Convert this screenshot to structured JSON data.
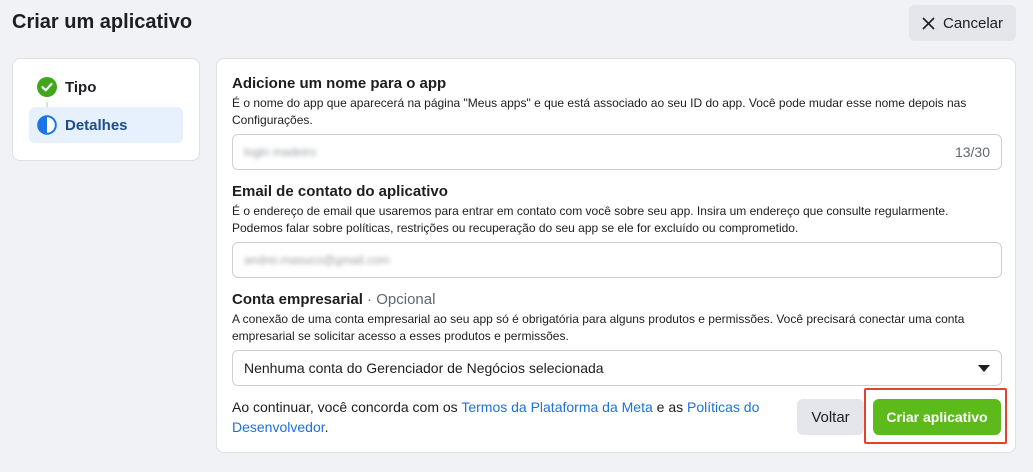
{
  "header": {
    "title": "Criar um aplicativo",
    "cancel_label": "Cancelar"
  },
  "steps": [
    {
      "label": "Tipo",
      "state": "completed",
      "icon": "check-circle-icon"
    },
    {
      "label": "Detalhes",
      "state": "active",
      "icon": "half-circle-icon"
    }
  ],
  "form": {
    "app_name": {
      "label": "Adicione um nome para o app",
      "description": "É o nome do app que aparecerá na página \"Meus apps\" e que está associado ao seu ID do app. Você pode mudar esse nome depois nas Configurações.",
      "value": "login madeiro",
      "counter": "13/30"
    },
    "email": {
      "label": "Email de contato do aplicativo",
      "description": "É o endereço de email que usaremos para entrar em contato com você sobre seu app. Insira um endereço que consulte regularmente. Podemos falar sobre políticas, restrições ou recuperação do seu app se ele for excluído ou comprometido.",
      "value": "andrei.masuco@gmail.com"
    },
    "business": {
      "label": "Conta empresarial",
      "optional": " · Opcional",
      "description": "A conexão de uma conta empresarial ao seu app só é obrigatória para alguns produtos e permissões. Você precisará conectar uma conta empresarial se solicitar acesso a esses produtos e permissões.",
      "selected": "Nenhuma conta do Gerenciador de Negócios selecionada"
    }
  },
  "footer": {
    "text_before": "Ao continuar, você concorda com os ",
    "link1": "Termos da Plataforma da Meta",
    "text_middle": " e as ",
    "link2": "Políticas do Desenvolvedor",
    "text_after": ".",
    "back_label": "Voltar",
    "create_label": "Criar aplicativo"
  },
  "colors": {
    "accent_green": "#5cba1b",
    "link_blue": "#216fdb",
    "highlight_red": "#e0452b"
  }
}
